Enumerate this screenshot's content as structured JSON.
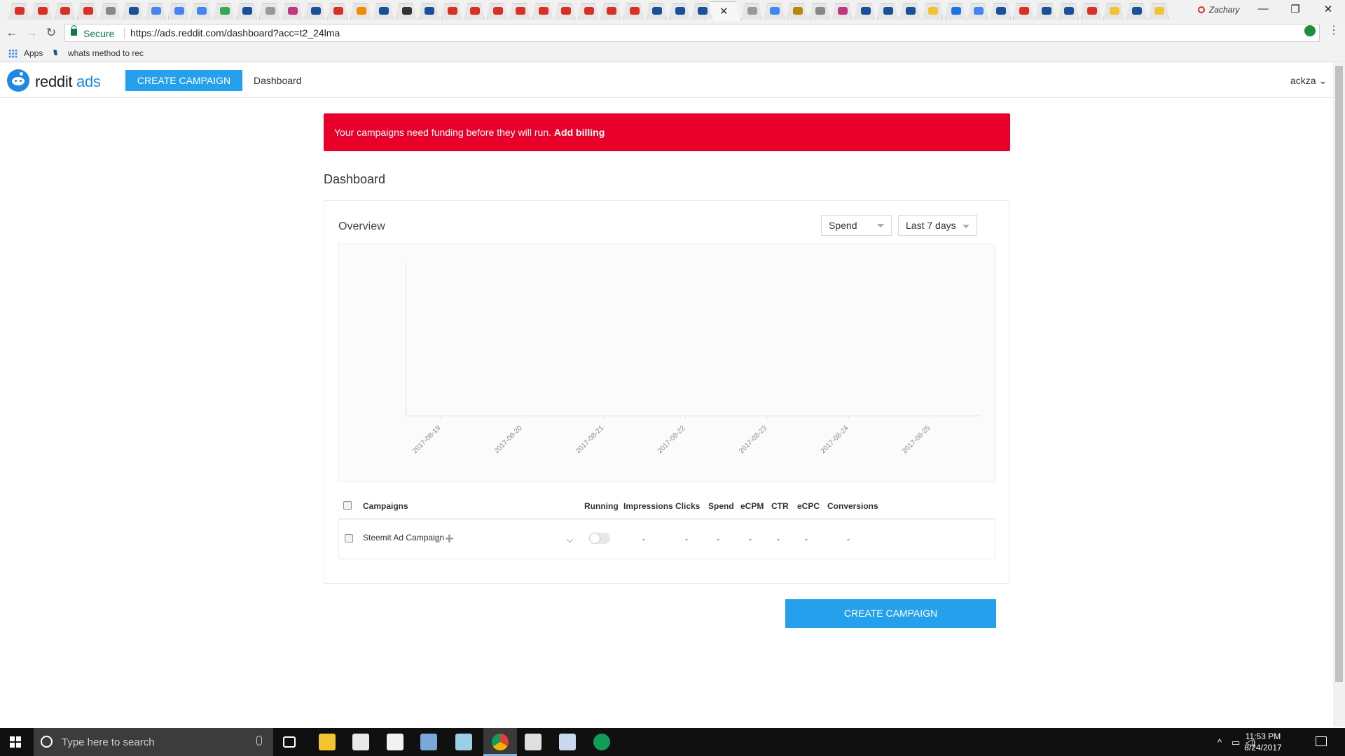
{
  "browser": {
    "profile_name": "Zachary",
    "active_tab_close": "✕",
    "secure_label": "Secure",
    "url": "https://ads.reddit.com/dashboard?acc=t2_24lma",
    "bookmarks": [
      {
        "label": "Apps"
      },
      {
        "label": "whats method to rec"
      }
    ]
  },
  "header": {
    "logo_text": "reddit",
    "logo_ads": "ads",
    "create_button": "CREATE CAMPAIGN",
    "nav_dashboard": "Dashboard",
    "user": "ackza ⌄"
  },
  "alert": {
    "message": "Your campaigns need funding before they will run.",
    "link": "Add billing"
  },
  "page": {
    "title": "Dashboard"
  },
  "overview": {
    "title": "Overview",
    "metric_select": "Spend",
    "range_select": "Last 7 days"
  },
  "chart_data": {
    "type": "line",
    "title": "",
    "xlabel": "",
    "ylabel": "",
    "categories": [
      "2017-08-19",
      "2017-08-20",
      "2017-08-21",
      "2017-08-22",
      "2017-08-23",
      "2017-08-24",
      "2017-08-25"
    ],
    "series": [],
    "grid": false
  },
  "table": {
    "columns": [
      "Campaigns",
      "Running",
      "Impressions",
      "Clicks",
      "Spend",
      "eCPM",
      "CTR",
      "eCPC",
      "Conversions"
    ],
    "rows": [
      {
        "name": "Steemit Ad Campaign",
        "running": false,
        "impressions": "-",
        "clicks": "-",
        "spend": "-",
        "ecpm": "-",
        "ctr": "-",
        "ecpc": "-",
        "conversions": "-"
      }
    ]
  },
  "footer": {
    "create_button": "CREATE CAMPAIGN"
  },
  "taskbar": {
    "search_placeholder": "Type here to search",
    "time": "11:53 PM",
    "date": "8/24/2017"
  },
  "colors": {
    "accent": "#24a0ed",
    "alert": "#e8002a"
  }
}
